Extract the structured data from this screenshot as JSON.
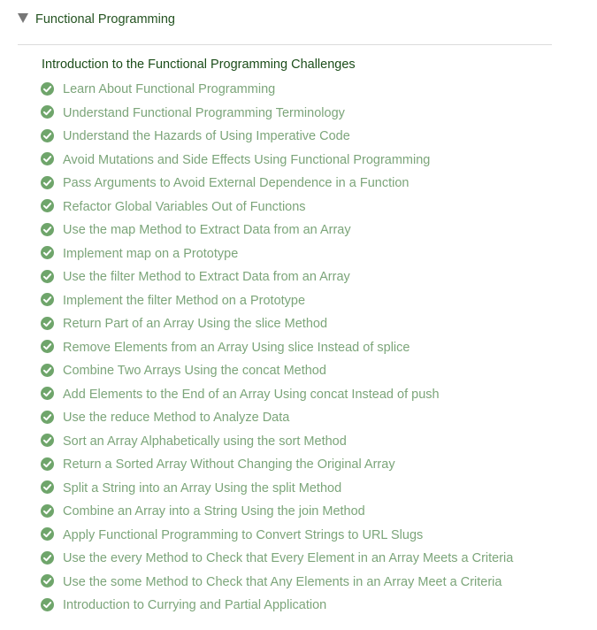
{
  "section": {
    "title": "Functional Programming",
    "expanded": true
  },
  "intro": {
    "label": "Introduction to the Functional Programming Challenges"
  },
  "colors": {
    "section_title": "#245321",
    "intro_link": "#1c4d1a",
    "completed_text": "#7ca57a",
    "check_icon": "#6fa56b",
    "divider": "#dcdcdc"
  },
  "icons": {
    "caret": "triangle-down-icon",
    "status": "check-circle-icon"
  },
  "challenges": [
    {
      "label": "Learn About Functional Programming",
      "completed": true
    },
    {
      "label": "Understand Functional Programming Terminology",
      "completed": true
    },
    {
      "label": "Understand the Hazards of Using Imperative Code",
      "completed": true
    },
    {
      "label": "Avoid Mutations and Side Effects Using Functional Programming",
      "completed": true
    },
    {
      "label": "Pass Arguments to Avoid External Dependence in a Function",
      "completed": true
    },
    {
      "label": "Refactor Global Variables Out of Functions",
      "completed": true
    },
    {
      "label": "Use the map Method to Extract Data from an Array",
      "completed": true
    },
    {
      "label": "Implement map on a Prototype",
      "completed": true
    },
    {
      "label": "Use the filter Method to Extract Data from an Array",
      "completed": true
    },
    {
      "label": "Implement the filter Method on a Prototype",
      "completed": true
    },
    {
      "label": "Return Part of an Array Using the slice Method",
      "completed": true
    },
    {
      "label": "Remove Elements from an Array Using slice Instead of splice",
      "completed": true
    },
    {
      "label": "Combine Two Arrays Using the concat Method",
      "completed": true
    },
    {
      "label": "Add Elements to the End of an Array Using concat Instead of push",
      "completed": true
    },
    {
      "label": "Use the reduce Method to Analyze Data",
      "completed": true
    },
    {
      "label": "Sort an Array Alphabetically using the sort Method",
      "completed": true
    },
    {
      "label": "Return a Sorted Array Without Changing the Original Array",
      "completed": true
    },
    {
      "label": "Split a String into an Array Using the split Method",
      "completed": true
    },
    {
      "label": "Combine an Array into a String Using the join Method",
      "completed": true
    },
    {
      "label": "Apply Functional Programming to Convert Strings to URL Slugs",
      "completed": true
    },
    {
      "label": "Use the every Method to Check that Every Element in an Array Meets a Criteria",
      "completed": true
    },
    {
      "label": "Use the some Method to Check that Any Elements in an Array Meet a Criteria",
      "completed": true
    },
    {
      "label": "Introduction to Currying and Partial Application",
      "completed": true
    }
  ]
}
